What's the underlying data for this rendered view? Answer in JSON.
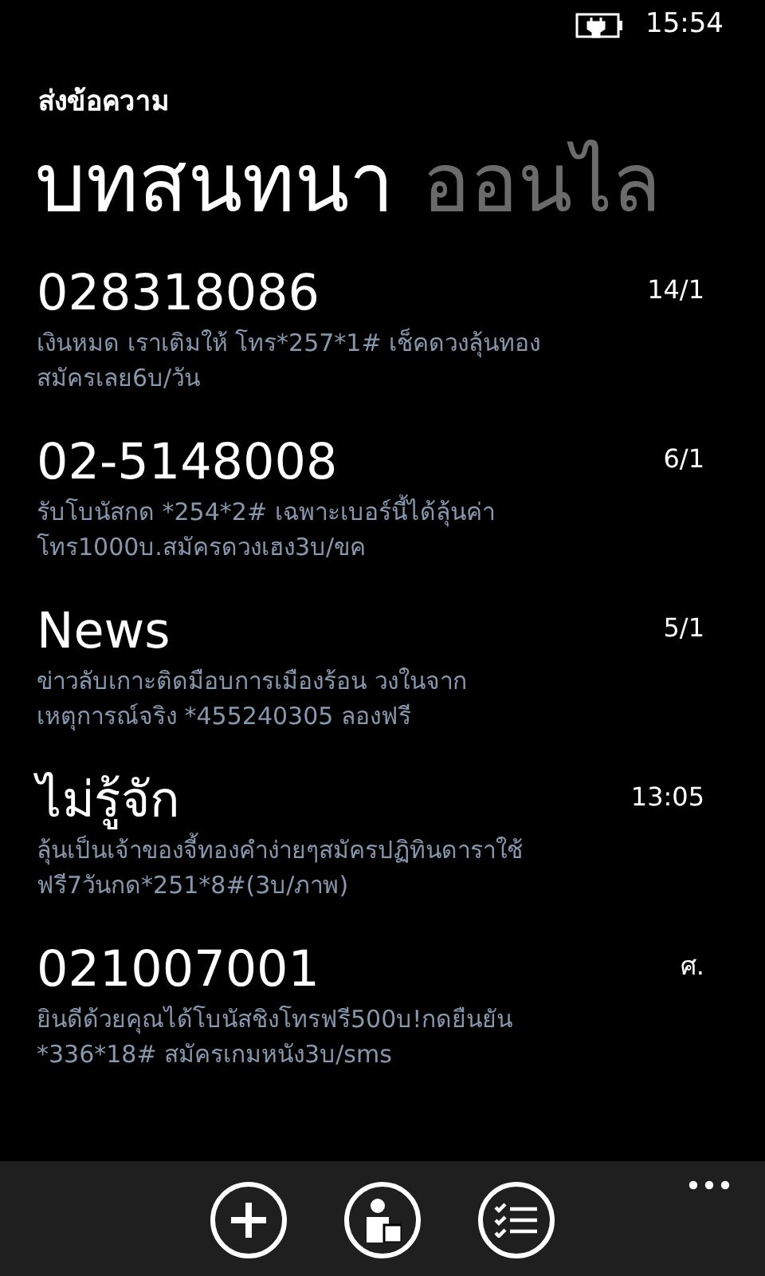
{
  "status_bar": {
    "time": "15:54"
  },
  "app_title": "ส่งข้อความ",
  "pivots": [
    {
      "label": "บทสนทนา",
      "selected": true
    },
    {
      "label": "ออนไล",
      "selected": false
    }
  ],
  "conversations": [
    {
      "name": "028318086",
      "time": "14/1",
      "preview_lines": [
        "เงินหมด เราเติมให้  โทร*257*1# เช็คดวงลุ้นทอง",
        "สมัครเลย6บ/วัน"
      ]
    },
    {
      "name": "02-5148008",
      "time": "6/1",
      "preview_lines": [
        "รับโบนัสกด *254*2# เฉพาะเบอร์นี้ได้ลุ้นค่า",
        "โทร1000บ.สมัครดวงเฮง3บ/ขค"
      ]
    },
    {
      "name": "News",
      "time": "5/1",
      "preview_lines": [
        "ข่าวลับเกาะติดมือบการเมืองร้อน วงในจาก",
        "เหตุการณ์จริง *455240305 ลองฟรี"
      ]
    },
    {
      "name": "ไม่รู้จัก",
      "time": "13:05",
      "preview_lines": [
        "ลุ้นเป็นเจ้าของจี้ทองคำง่ายๆสมัครปฏิทินดาราใช้",
        "ฟรี7วันกด*251*8#(3บ/ภาพ)"
      ]
    },
    {
      "name": "021007001",
      "time": "ศ.",
      "preview_lines": [
        "ยินดีด้วยคุณได้โบนัสชิงโทรฟรี500บ!กดยืนยัน",
        "*336*18# สมัครเกมหนัง3บ/sms"
      ]
    }
  ]
}
